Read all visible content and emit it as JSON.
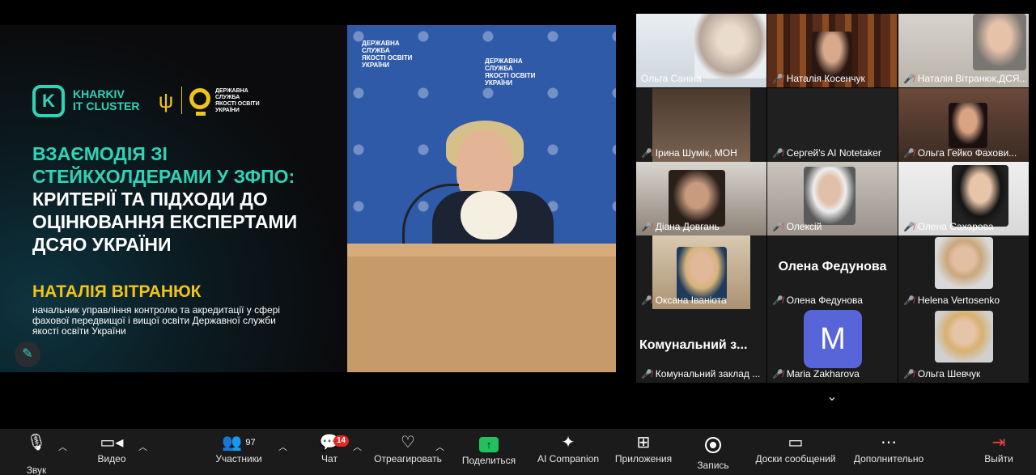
{
  "slide": {
    "logo_letter": "K",
    "org_line1": "KHARKIV",
    "org_line2": "IT CLUSTER",
    "agency_line1": "ДЕРЖАВНА",
    "agency_line2": "СЛУЖБА",
    "agency_line3": "ЯКОСТІ ОСВІТИ",
    "agency_line4": "УКРАЇНИ",
    "title_accent": "Взаємодія зі стейкхолдерами у ЗФПО:",
    "title_main": "критерії та підходи до оцінювання експертами ДСЯО України",
    "speaker": "НАТАЛІЯ ВІТРАНЮК",
    "speaker_role": "начальник управління контролю та акредитації у сфері фахової передвищої і вищої освіти Державної служби якості освіти України"
  },
  "stage": {
    "backdrop_line1": "ДЕРЖАВНА",
    "backdrop_line2": "СЛУЖБА",
    "backdrop_line3": "ЯКОСТІ ОСВІТИ",
    "backdrop_line4": "УКРАЇНИ"
  },
  "gallery": {
    "tiles": [
      {
        "name": "Ольга Саніна",
        "muted": false,
        "active": true
      },
      {
        "name": "Наталія Косенчук",
        "muted": true
      },
      {
        "name": "Наталія Вітранюк,ДСЯ...",
        "muted": true
      },
      {
        "name": "Ірина Шумік, МОН",
        "muted": true
      },
      {
        "name": "Сергей's AI Notetaker",
        "muted": true
      },
      {
        "name": "Ольга Гейко  Фахови...",
        "muted": true
      },
      {
        "name": "Діана Довгань",
        "muted": true
      },
      {
        "name": "Олексій",
        "muted": true
      },
      {
        "name": "Олена Сахарова",
        "muted": true
      },
      {
        "name": "Оксана Іваніота",
        "muted": true
      },
      {
        "name": "Олена Федунова",
        "muted": true,
        "big_label": "Олена Федунова"
      },
      {
        "name": "Helena Vertosenko",
        "muted": true
      },
      {
        "name": "Комунальний заклад ...",
        "muted": true,
        "big_label": "Комунальний  з..."
      },
      {
        "name": "Maria Zakharova",
        "muted": true,
        "avatar": "M"
      },
      {
        "name": "Ольга Шевчук",
        "muted": true
      }
    ]
  },
  "toolbar": {
    "mute": "Звук",
    "video": "Видео",
    "participants": "Участники",
    "participants_count": "97",
    "chat": "Чат",
    "chat_badge": "14",
    "react": "Отреагировать",
    "share": "Поделиться",
    "ai": "AI Companion",
    "apps": "Приложения",
    "record": "Запись",
    "whiteboards": "Доски сообщений",
    "more": "Дополнительно",
    "leave": "Выйти"
  },
  "colors": {
    "accent_teal": "#2fd4b7",
    "accent_yellow": "#f0c419",
    "share_green": "#22c15e",
    "muted_red": "#e44444",
    "active_speaker": "#39d86a"
  }
}
